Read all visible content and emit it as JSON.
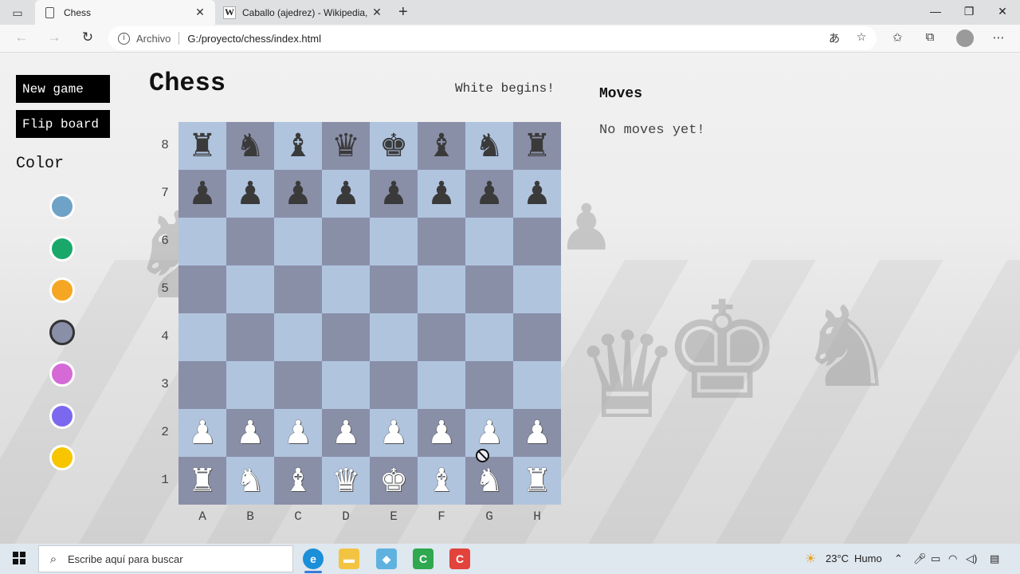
{
  "browser": {
    "tabs": [
      {
        "title": "Chess",
        "active": true
      },
      {
        "title": "Caballo (ajedrez) - Wikipedia, la",
        "active": false
      }
    ],
    "address": {
      "scheme_label": "Archivo",
      "url": "G:/proyecto/chess/index.html"
    }
  },
  "sidebar": {
    "new_game_label": "New game",
    "flip_board_label": "Flip board",
    "color_heading": "Color",
    "colors": [
      "#6fa2c7",
      "#1aa86a",
      "#f5a623",
      "#8a8fa8",
      "#d56ad6",
      "#7b68ee",
      "#f7c600"
    ],
    "selected_color": "#8a8fa8"
  },
  "game": {
    "title": "Chess",
    "status": "White begins!",
    "light_square": "#b0c4de",
    "dark_square": "#8a8fa8",
    "ranks": [
      "8",
      "7",
      "6",
      "5",
      "4",
      "3",
      "2",
      "1"
    ],
    "files": [
      "A",
      "B",
      "C",
      "D",
      "E",
      "F",
      "G",
      "H"
    ],
    "position": [
      [
        "r",
        "n",
        "b",
        "q",
        "k",
        "b",
        "n",
        "r"
      ],
      [
        "p",
        "p",
        "p",
        "p",
        "p",
        "p",
        "p",
        "p"
      ],
      [
        "",
        "",
        "",
        "",
        "",
        "",
        "",
        ""
      ],
      [
        "",
        "",
        "",
        "",
        "",
        "",
        "",
        ""
      ],
      [
        "",
        "",
        "",
        "",
        "",
        "",
        "",
        ""
      ],
      [
        "",
        "",
        "",
        "",
        "",
        "",
        "",
        ""
      ],
      [
        "P",
        "P",
        "P",
        "P",
        "P",
        "P",
        "P",
        "P"
      ],
      [
        "R",
        "N",
        "B",
        "Q",
        "K",
        "B",
        "N",
        "R"
      ]
    ]
  },
  "moves": {
    "title": "Moves",
    "empty_text": "No moves yet!"
  },
  "taskbar": {
    "search_placeholder": "Escribe aquí para buscar",
    "weather_temp": "23°C",
    "weather_text": "Humo"
  }
}
